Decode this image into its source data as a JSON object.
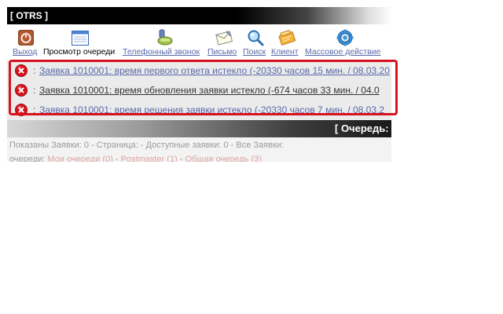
{
  "app": {
    "title": "[ OTRS ]"
  },
  "toolbar": {
    "items": [
      {
        "label": "Выход",
        "icon": "power-icon"
      },
      {
        "label": "Просмотр очереди",
        "icon": "queue-window-icon"
      },
      {
        "label": "Телефонный звонок",
        "icon": "phone-icon"
      },
      {
        "label": "Письмо",
        "icon": "email-icon"
      },
      {
        "label": "Поиск",
        "icon": "search-icon"
      },
      {
        "label": "Клиент",
        "icon": "customer-icon"
      },
      {
        "label": "Массовое действие",
        "icon": "bulk-action-icon"
      }
    ]
  },
  "notifications": {
    "separator": ":",
    "items": [
      {
        "text": "Заявка 1010001: время первого ответа истекло (-20330 часов 15 мин. / 08.03.20",
        "icon": "error-icon"
      },
      {
        "text": "Заявка 1010001: время обновления заявки истекло (-674 часов 33 мин. / 04.0",
        "icon": "error-icon"
      },
      {
        "text": "Заявка 1010001: время решения заявки истекло (-20330 часов 7 мин. / 08.03.2",
        "icon": "error-icon"
      }
    ]
  },
  "queue": {
    "title": "[ Очередь:"
  },
  "stats": {
    "line1": "Показаны Заявки: 0 - Страница: - Доступные заявки: 0 - Все Заявки:",
    "line2_prefix": "очереди:",
    "my_queues": "Мои очереди (0)",
    "dash": "-",
    "postmaster": "Postmaster (1)",
    "common_queue": "Общая очередь (3)"
  },
  "colors": {
    "link": "#5869a8",
    "highlight": "#d8121d",
    "error": "#d8121d",
    "muted": "#9a9a9a"
  }
}
